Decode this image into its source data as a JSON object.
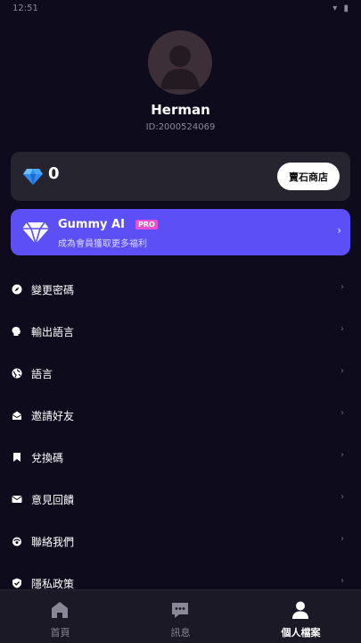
{
  "status_bar": {
    "time": "12:51",
    "icons": "▾ ▮"
  },
  "profile": {
    "name": "Herman",
    "id": "ID:2000524069"
  },
  "gems": {
    "count": "0",
    "shop_label": "賣石商店",
    "icon": "diamond-icon"
  },
  "pro_banner": {
    "title": "Gummy AI",
    "badge": "PRO",
    "subtitle": "成為會員獲取更多福利",
    "chevron": "›"
  },
  "menu": {
    "chevron": "›",
    "items": [
      {
        "label": "變更密碼",
        "icon": "compass-icon"
      },
      {
        "label": "輸出語言",
        "icon": "speaking-head-icon"
      },
      {
        "label": "語言",
        "icon": "globe-icon"
      },
      {
        "label": "邀請好友",
        "icon": "envelope-icon"
      },
      {
        "label": "兌換碼",
        "icon": "bookmark-icon"
      },
      {
        "label": "意見回饋",
        "icon": "mail-icon"
      },
      {
        "label": "聯絡我們",
        "icon": "headset-icon"
      },
      {
        "label": "隱私政策",
        "icon": "shield-check-icon"
      }
    ]
  },
  "tabs": [
    {
      "label": "首頁",
      "icon": "home-icon",
      "active": false
    },
    {
      "label": "訊息",
      "icon": "chat-bubble-icon",
      "active": false
    },
    {
      "label": "個人檔案",
      "icon": "person-icon",
      "active": true
    }
  ],
  "colors": {
    "background": "#0d0b1c",
    "card": "#26242f",
    "accent": "#5b4ff5",
    "pro_badge": "#e94fd1"
  }
}
